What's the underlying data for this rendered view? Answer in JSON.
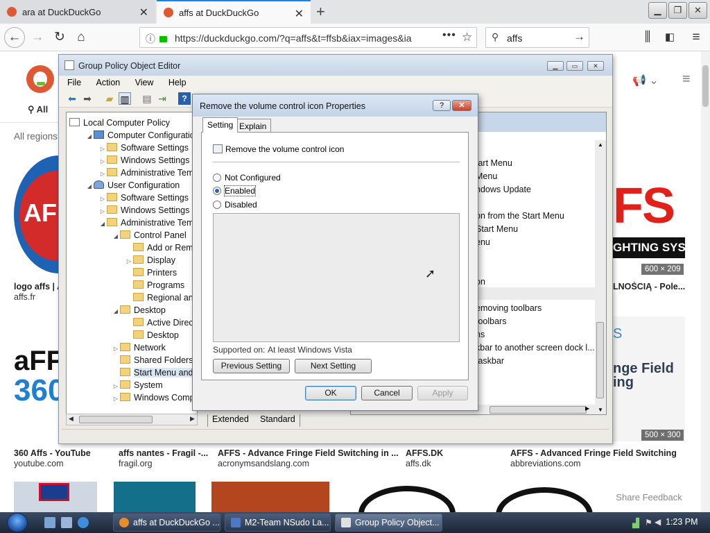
{
  "browser": {
    "tabs": [
      {
        "label": "ara at DuckDuckGo"
      },
      {
        "label": "affs at DuckDuckGo"
      }
    ],
    "url": "https://duckduckgo.com/?q=affs&t=ffsb&iax=images&ia",
    "search_value": "affs",
    "colors": {
      "tab_accent": "#0a84ff",
      "ddg_brand": "#de5833"
    }
  },
  "ddg": {
    "nav_all": "All",
    "regions_label": "All regions",
    "size_badges": [
      "600 × 209",
      "500 × 300"
    ],
    "results_row1": [
      {
        "title": "logo affs | A",
        "source": "affs.fr"
      },
      {
        "title": "LNOŚCIĄ - Pole...",
        "source": ""
      }
    ],
    "thumb_text": {
      "affs_banner": "FS",
      "affs_banner_sub": "GHTING SYST",
      "fringe_text": "nge Field",
      "fringe_text2": "ing",
      "aff_logo": "AFFS"
    },
    "results_row2": [
      {
        "title": "360 Affs - YouTube",
        "source": "youtube.com"
      },
      {
        "title": "affs nantes - Fragil -...",
        "source": "fragil.org"
      },
      {
        "title": "AFFS - Advance Fringe Field Switching in ...",
        "source": "acronymsandslang.com"
      },
      {
        "title": "AFFS.DK",
        "source": "affs.dk"
      },
      {
        "title": "AFFS - Advanced Fringe Field Switching",
        "source": "abbreviations.com"
      }
    ],
    "share_feedback": "Share Feedback"
  },
  "gpedit": {
    "title": "Group Policy Object Editor",
    "menu": [
      "File",
      "Action",
      "View",
      "Help"
    ],
    "tree": [
      {
        "label": "Local Computer Policy",
        "level": 0,
        "exp": "",
        "kind": "root"
      },
      {
        "label": "Computer Configuration",
        "level": 1,
        "exp": "◢",
        "kind": "computer"
      },
      {
        "label": "Software Settings",
        "level": 2,
        "exp": "▷",
        "kind": "folder"
      },
      {
        "label": "Windows Settings",
        "level": 2,
        "exp": "▷",
        "kind": "folder"
      },
      {
        "label": "Administrative Templa",
        "level": 2,
        "exp": "▷",
        "kind": "folder"
      },
      {
        "label": "User Configuration",
        "level": 1,
        "exp": "◢",
        "kind": "user"
      },
      {
        "label": "Software Settings",
        "level": 2,
        "exp": "▷",
        "kind": "folder"
      },
      {
        "label": "Windows Settings",
        "level": 2,
        "exp": "▷",
        "kind": "folder"
      },
      {
        "label": "Administrative Templa",
        "level": 2,
        "exp": "◢",
        "kind": "folder"
      },
      {
        "label": "Control Panel",
        "level": 3,
        "exp": "◢",
        "kind": "folder"
      },
      {
        "label": "Add or Remove",
        "level": 4,
        "exp": "",
        "kind": "folder"
      },
      {
        "label": "Display",
        "level": 4,
        "exp": "▷",
        "kind": "folder"
      },
      {
        "label": "Printers",
        "level": 4,
        "exp": "",
        "kind": "folder"
      },
      {
        "label": "Programs",
        "level": 4,
        "exp": "",
        "kind": "folder"
      },
      {
        "label": "Regional and L",
        "level": 4,
        "exp": "",
        "kind": "folder"
      },
      {
        "label": "Desktop",
        "level": 3,
        "exp": "◢",
        "kind": "folder"
      },
      {
        "label": "Active Director",
        "level": 4,
        "exp": "",
        "kind": "folder"
      },
      {
        "label": "Desktop",
        "level": 4,
        "exp": "",
        "kind": "folder"
      },
      {
        "label": "Network",
        "level": 3,
        "exp": "▷",
        "kind": "folder"
      },
      {
        "label": "Shared Folders",
        "level": 3,
        "exp": "",
        "kind": "folder"
      },
      {
        "label": "Start Menu and Ta",
        "level": 3,
        "exp": "",
        "kind": "folder",
        "selected": true
      },
      {
        "label": "System",
        "level": 3,
        "exp": "▷",
        "kind": "folder"
      },
      {
        "label": "Windows Compon",
        "level": 3,
        "exp": "▷",
        "kind": "folder"
      }
    ],
    "right_items": [
      "tart Menu",
      "Menu",
      "ndows Update",
      "",
      "on from the Start Menu",
      "Start Menu",
      "enu",
      "",
      "",
      "on",
      "",
      "emoving toolbars",
      "toolbars",
      "ns",
      "kbar to another screen dock l...",
      "taskbar"
    ],
    "tabs": [
      "Extended",
      "Standard"
    ]
  },
  "dialog": {
    "title": "Remove the volume control icon Properties",
    "help_btn": "?",
    "close_btn": "✕",
    "tabs": [
      "Setting",
      "Explain"
    ],
    "setting_name": "Remove the volume control icon",
    "options": [
      "Not Configured",
      "Enabled",
      "Disabled"
    ],
    "selected_option": "Enabled",
    "supported_label": "Supported on:",
    "supported_value": "At least Windows Vista",
    "prev_button": "Previous Setting",
    "next_button": "Next Setting",
    "ok": "OK",
    "cancel": "Cancel",
    "apply": "Apply"
  },
  "taskbar": {
    "tasks": [
      "affs at DuckDuckGo ...",
      "M2-Team NSudo La...",
      "Group Policy Object..."
    ],
    "clock": "1:23 PM"
  }
}
